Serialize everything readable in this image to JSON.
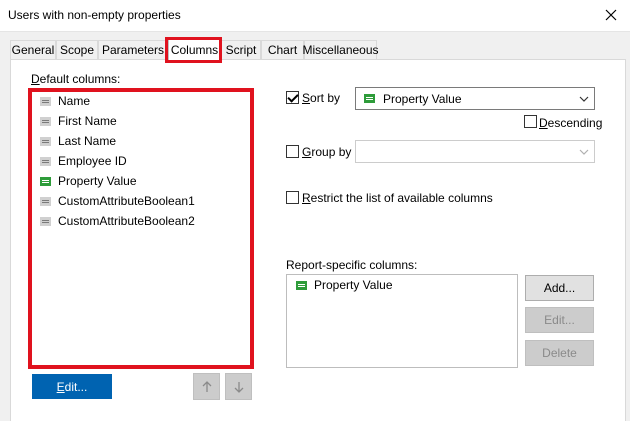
{
  "window": {
    "title": "Users with non-empty properties"
  },
  "tabs": [
    {
      "label": "General"
    },
    {
      "label": "Scope"
    },
    {
      "label": "Parameters"
    },
    {
      "label": "Columns"
    },
    {
      "label": "Script"
    },
    {
      "label": "Chart"
    },
    {
      "label": "Miscellaneous"
    }
  ],
  "active_tab": "Columns",
  "default_columns": {
    "label_prefix": "D",
    "label_rest": "efault columns:",
    "items": [
      {
        "label": "Name",
        "icon": "grey-column-icon"
      },
      {
        "label": "First Name",
        "icon": "grey-column-icon"
      },
      {
        "label": "Last Name",
        "icon": "grey-column-icon"
      },
      {
        "label": "Employee ID",
        "icon": "grey-column-icon"
      },
      {
        "label": "Property Value",
        "icon": "green-column-icon"
      },
      {
        "label": "CustomAttributeBoolean1",
        "icon": "grey-column-icon"
      },
      {
        "label": "CustomAttributeBoolean2",
        "icon": "grey-column-icon"
      }
    ],
    "edit_button_prefix": "E",
    "edit_button_rest": "dit..."
  },
  "sort": {
    "checkbox_prefix": "S",
    "checkbox_rest": "ort by",
    "checked": true,
    "value": "Property Value",
    "descending_label": "Descending",
    "descending_prefix": "D",
    "descending_rest": "escending"
  },
  "group": {
    "checkbox_prefix": "G",
    "checkbox_rest": "roup by",
    "checked": false,
    "value": ""
  },
  "restrict": {
    "label_prefix": "R",
    "label_rest": "estrict the list of available columns",
    "checked": false
  },
  "report_columns": {
    "label": "Report-specific columns:",
    "items": [
      {
        "label": "Property Value",
        "icon": "green-column-icon"
      }
    ],
    "add_label": "Add...",
    "edit_label": "Edit...",
    "delete_label": "Delete"
  },
  "colors": {
    "accent": "#0063b1",
    "highlight": "#e0121e",
    "green_icon": "#2e9c3a"
  }
}
